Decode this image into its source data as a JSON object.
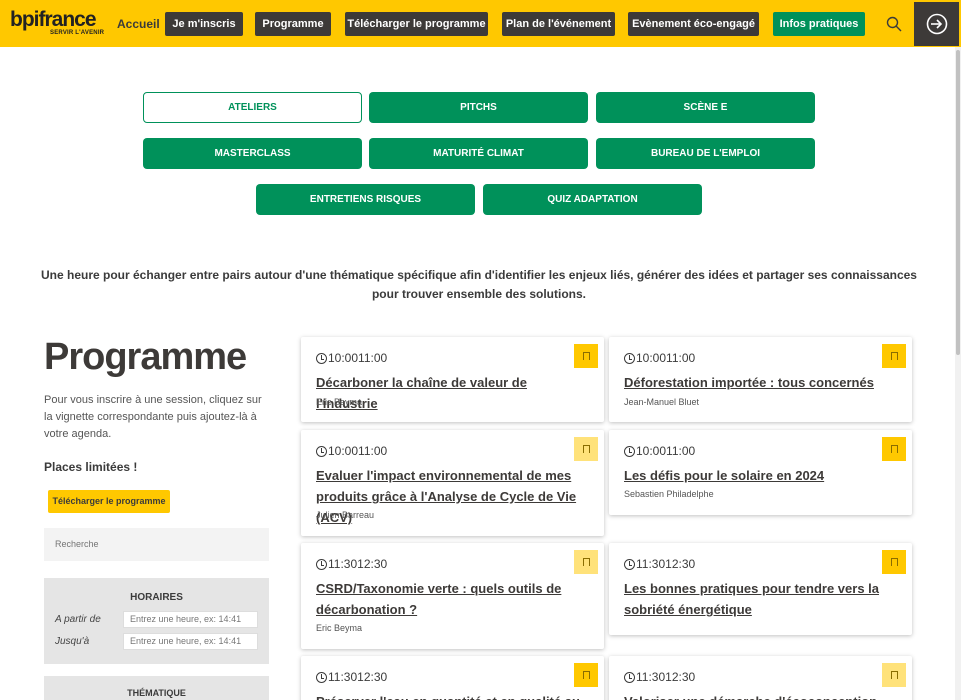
{
  "header": {
    "logo": "bpifrance",
    "logo_sub": "SERVIR L'AVENIR",
    "home": "Accueil",
    "nav": [
      "Je m'inscris",
      "Programme",
      "Télécharger le programme",
      "Plan de l'événement",
      "Evènement éco-engagé",
      "Infos pratiques"
    ]
  },
  "tabs": [
    "Ateliers",
    "Pitchs",
    "Scène E",
    "Masterclass",
    "Maturité climat",
    "Bureau de l'emploi",
    "Entretiens risques",
    "Quiz adaptation"
  ],
  "intro": "Une heure pour échanger entre pairs autour d'une thématique spécifique afin d'identifier les enjeux liés, générer des idées et partager ses connaissances pour trouver ensemble des solutions.",
  "sidebar": {
    "title": "Programme",
    "description": "Pour vous inscrire à une session, cliquez sur la vignette correspondante puis ajoutez-là à votre agenda.",
    "places": "Places limitées !",
    "download": "Télécharger le programme",
    "search_placeholder": "Recherche",
    "hours_title": "HORAIRES",
    "from_label": "A partir de",
    "to_label": "Jusqu'à",
    "time_placeholder": "Entrez une heure, ex: 14:41",
    "theme_title": "THÉMATIQUE"
  },
  "cards": [
    {
      "time": "10:0011:00",
      "title": "Décarboner la chaîne de valeur de l'industrie",
      "speaker": "Eric Beyma"
    },
    {
      "time": "10:0011:00",
      "title": "Déforestation importée : tous concernés",
      "speaker": "Jean-Manuel Bluet"
    },
    {
      "time": "10:0011:00",
      "title": "Evaluer l'impact environnemental de mes produits grâce à l'Analyse de Cycle de Vie (ACV)",
      "speaker": "Julien Barreau"
    },
    {
      "time": "10:0011:00",
      "title": "Les défis pour le solaire en 2024",
      "speaker": "Sebastien Philadelphe"
    },
    {
      "time": "11:3012:30",
      "title": "CSRD/Taxonomie verte : quels outils de décarbonation ?",
      "speaker": "Eric Beyma"
    },
    {
      "time": "11:3012:30",
      "title": "Les bonnes pratiques pour tendre vers la sobriété énergétique",
      "speaker": ""
    },
    {
      "time": "11:3012:30",
      "title": "Préserver l'eau en quantité et en qualité au sein de",
      "speaker": ""
    },
    {
      "time": "11:3012:30",
      "title": "Valoriser une démarche d'écoconception auprès de",
      "speaker": ""
    }
  ]
}
